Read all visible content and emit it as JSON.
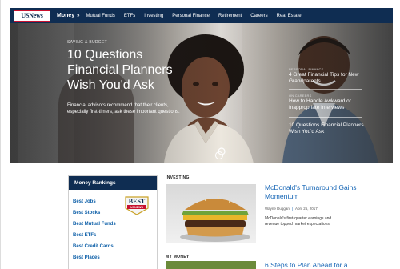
{
  "nav": {
    "logo_text": "USNews",
    "section_label": "Money",
    "links": [
      "Mutual Funds",
      "ETFs",
      "Investing",
      "Personal Finance",
      "Retirement",
      "Careers",
      "Real Estate"
    ]
  },
  "hero": {
    "eyebrow": "SAVING & BUDGET",
    "title": "10 Questions Financial Planners Wish You'd Ask",
    "description": "Financial advisors recommend that their clients, especially first-timers, ask these important questions.",
    "side_items": [
      {
        "category": "PERSONAL FINANCE",
        "title": "4 Great Financial Tips for New Grandparents"
      },
      {
        "category": "ON CAREERS",
        "title": "How to Handle Awkward or Inappropriate Interviews"
      },
      {
        "category": "",
        "title": "10 Questions Financial Planners Wish You'd Ask"
      }
    ]
  },
  "rankings": {
    "heading": "Money Rankings",
    "items": [
      "Best Jobs",
      "Best Stocks",
      "Best Mutual Funds",
      "Best ETFs",
      "Best Credit Cards",
      "Best Places"
    ],
    "badge_top": "BEST",
    "badge_bottom": "USNEWS"
  },
  "articles": [
    {
      "section": "INVESTING",
      "title": "McDonald's Turnaround Gains Momentum",
      "author": "Wayne Duggan",
      "date": "April 25, 2017",
      "description": "McDonald's first-quarter earnings and revenue topped market expectations."
    },
    {
      "section": "MY MONEY",
      "title": "6 Steps to Plan Ahead for a"
    }
  ],
  "colors": {
    "navy": "#0f2d52",
    "link_blue": "#1565b5",
    "logo_red": "#c8102e"
  }
}
